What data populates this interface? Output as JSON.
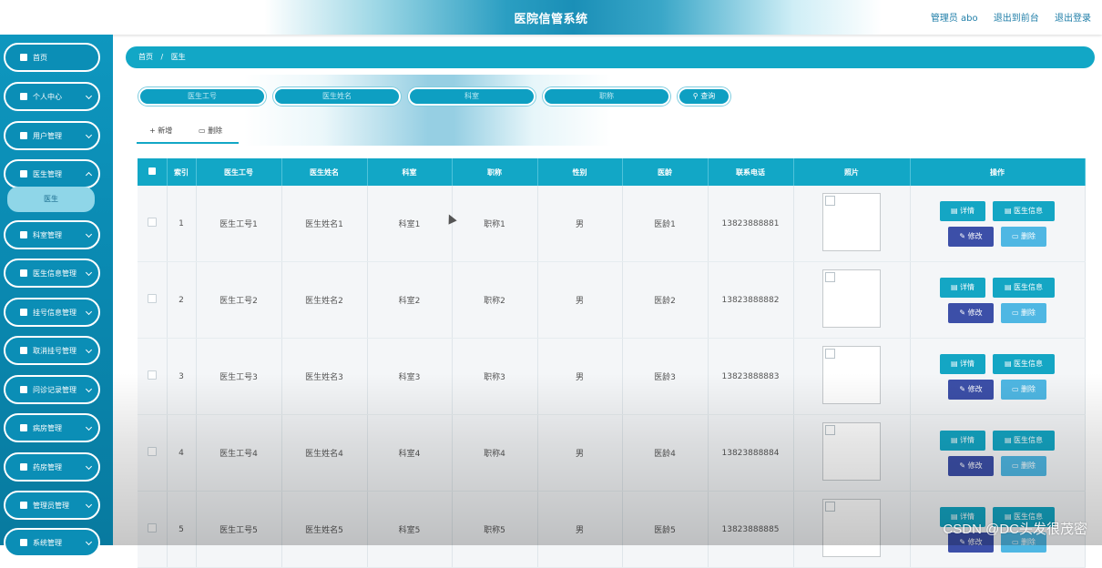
{
  "header": {
    "title": "医院信管系统",
    "admin_label": "管理员 abo",
    "back_front": "退出到前台",
    "logout": "退出登录"
  },
  "sidebar": {
    "items": [
      {
        "label": "首页"
      },
      {
        "label": "个人中心"
      },
      {
        "label": "用户管理"
      },
      {
        "label": "医生管理"
      },
      {
        "label": "科室管理"
      },
      {
        "label": "医生信息管理"
      },
      {
        "label": "挂号信息管理"
      },
      {
        "label": "取消挂号管理"
      },
      {
        "label": "问诊记录管理"
      },
      {
        "label": "病房管理"
      },
      {
        "label": "药房管理"
      },
      {
        "label": "管理员管理"
      },
      {
        "label": "系统管理"
      }
    ],
    "sub_item": "医生"
  },
  "breadcrumb": {
    "home": "首页",
    "sep": "/",
    "current": "医生"
  },
  "search": {
    "doctor_no": "医生工号",
    "doctor_name": "医生姓名",
    "department": "科室",
    "title": "职称",
    "query": "查询"
  },
  "tabs": {
    "add": "新增",
    "delete": "删除"
  },
  "table": {
    "headers": [
      "索引",
      "医生工号",
      "医生姓名",
      "科室",
      "职称",
      "性别",
      "医龄",
      "联系电话",
      "照片",
      "操作"
    ],
    "rows": [
      {
        "index": "1",
        "no": "医生工号1",
        "name": "医生姓名1",
        "dept": "科室1",
        "title": "职称1",
        "gender": "男",
        "years": "医龄1",
        "phone": "13823888881"
      },
      {
        "index": "2",
        "no": "医生工号2",
        "name": "医生姓名2",
        "dept": "科室2",
        "title": "职称2",
        "gender": "男",
        "years": "医龄2",
        "phone": "13823888882"
      },
      {
        "index": "3",
        "no": "医生工号3",
        "name": "医生姓名3",
        "dept": "科室3",
        "title": "职称3",
        "gender": "男",
        "years": "医龄3",
        "phone": "13823888883"
      },
      {
        "index": "4",
        "no": "医生工号4",
        "name": "医生姓名4",
        "dept": "科室4",
        "title": "职称4",
        "gender": "男",
        "years": "医龄4",
        "phone": "13823888884"
      },
      {
        "index": "5",
        "no": "医生工号5",
        "name": "医生姓名5",
        "dept": "科室5",
        "title": "职称5",
        "gender": "男",
        "years": "医龄5",
        "phone": "13823888885"
      }
    ],
    "ops": {
      "detail": "详情",
      "doctor_info": "医生信息",
      "edit": "修改",
      "delete": "删除"
    }
  },
  "watermark": "CSDN @DC头发很茂密",
  "colors": {
    "primary": "#12a7c6",
    "edit": "#3c4fa8",
    "delete": "#4fb7e3"
  }
}
